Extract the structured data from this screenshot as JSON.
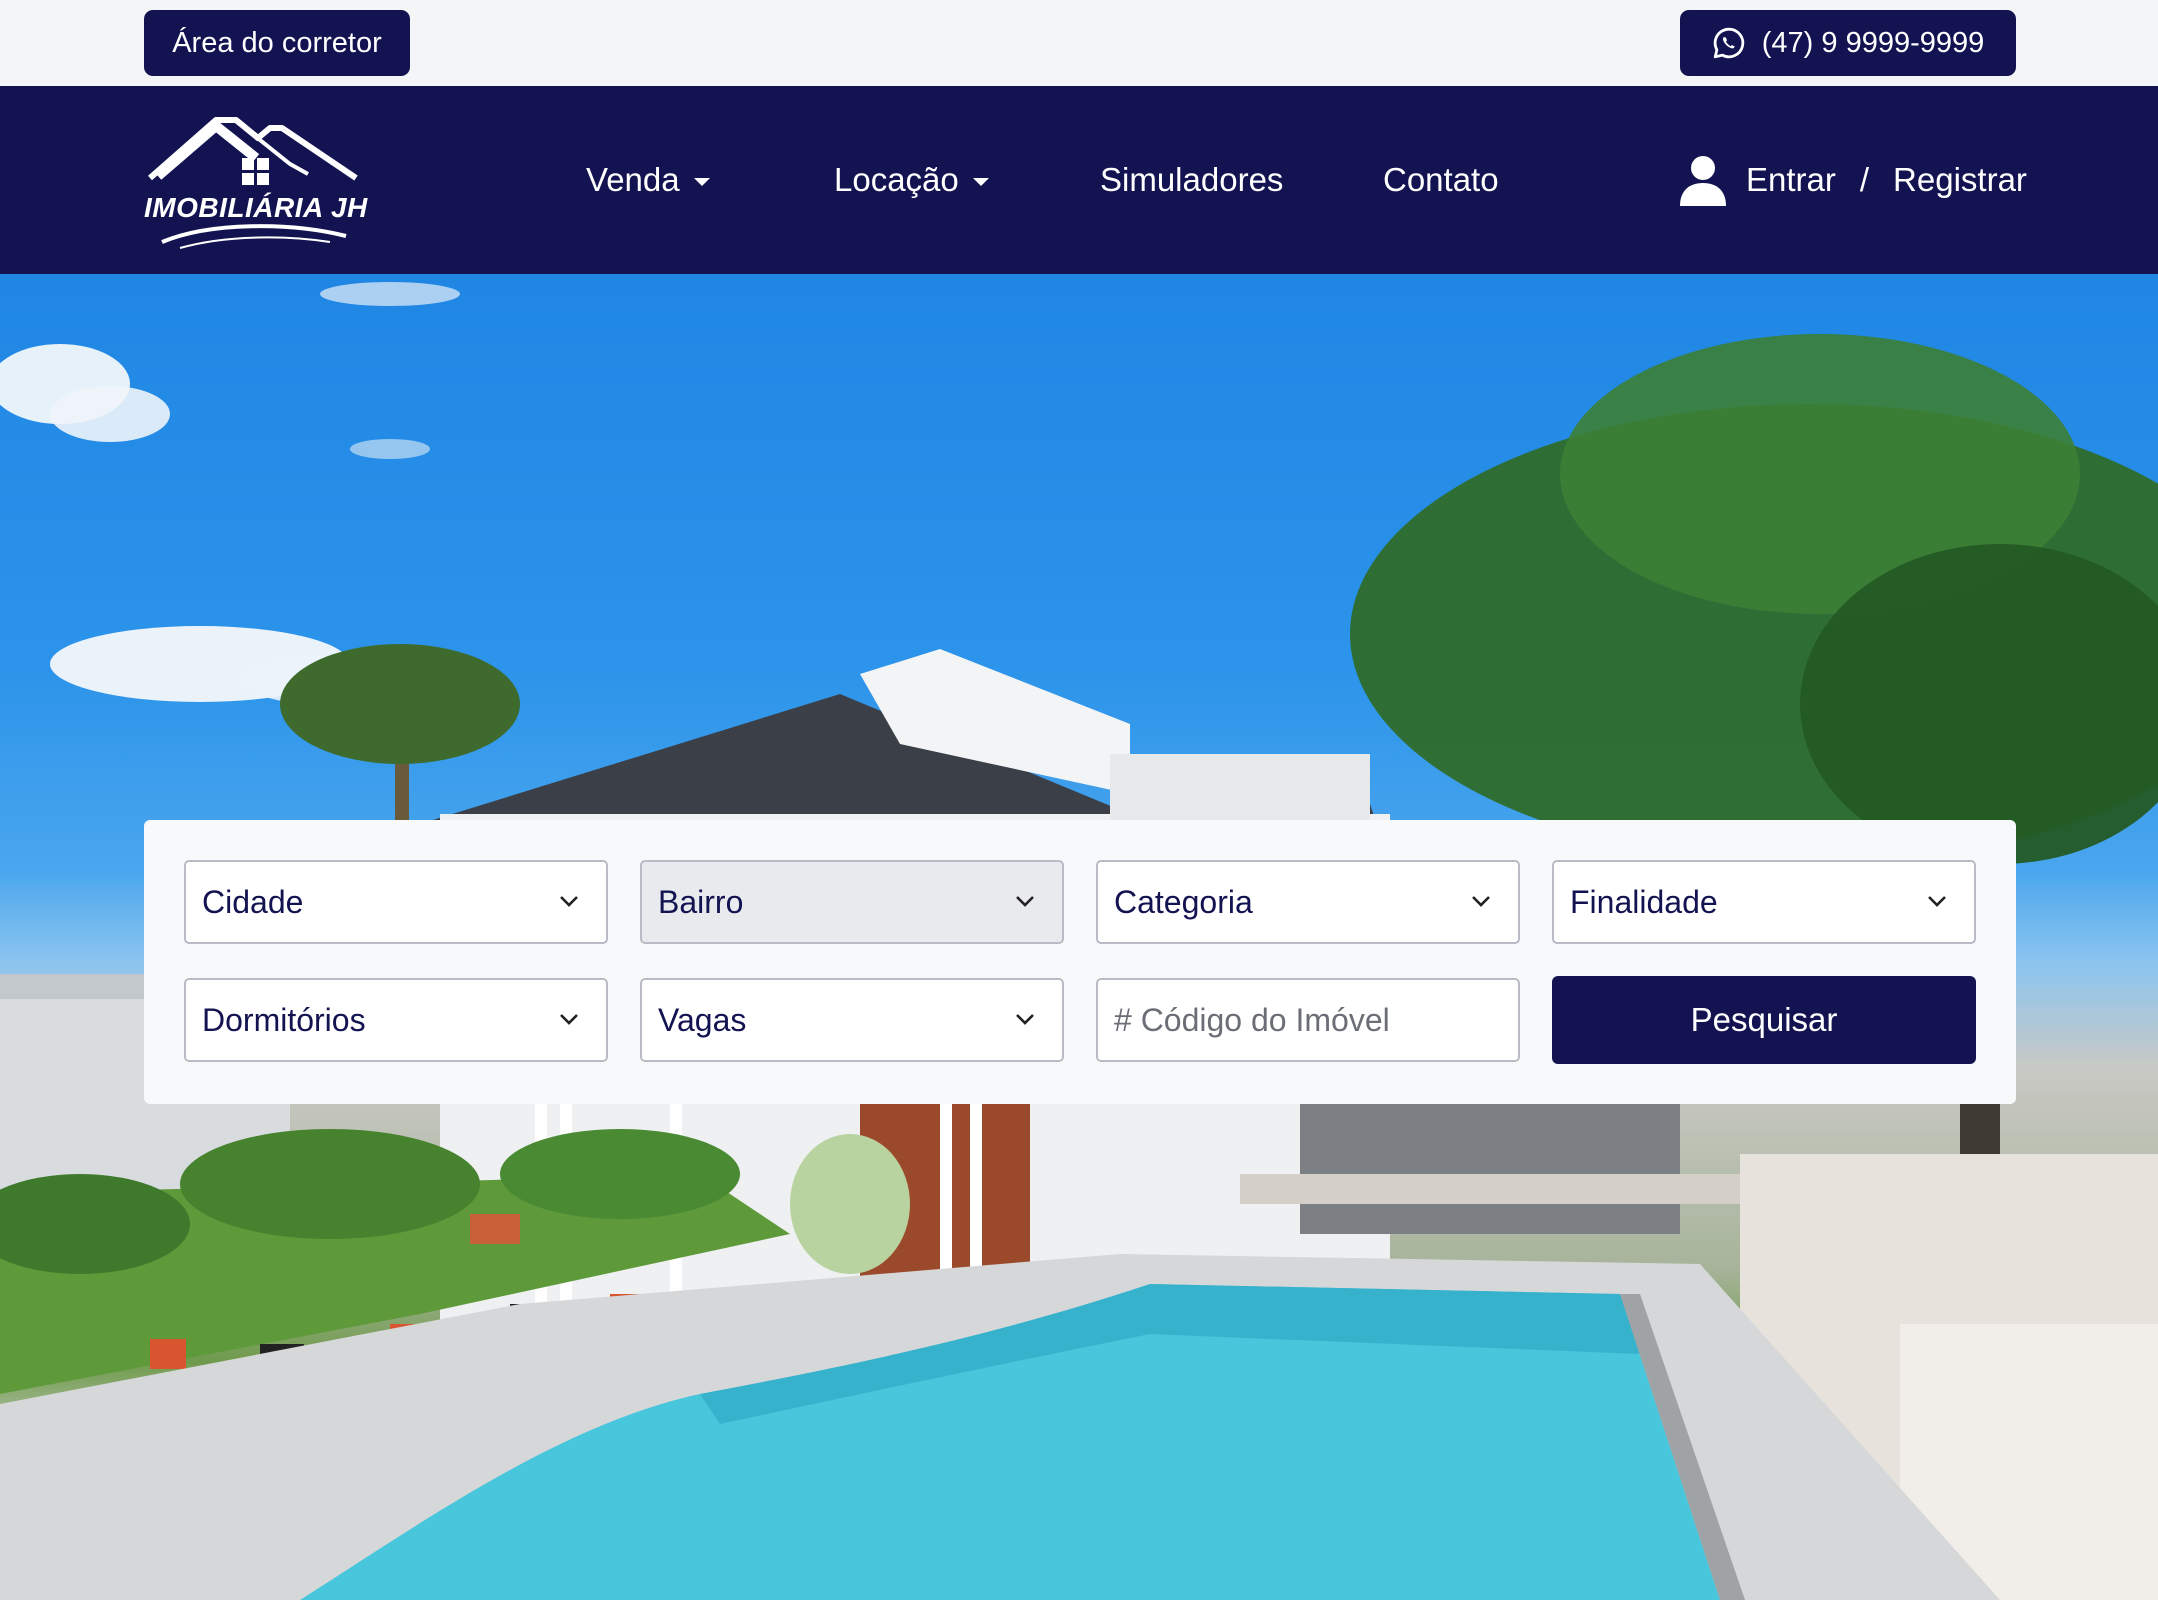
{
  "topbar": {
    "broker_area_label": "Área do corretor",
    "phone_label": "(47) 9 9999-9999",
    "phone_icon": "whatsapp-icon"
  },
  "nav": {
    "logo_text": "IMOBILIÁRIA JH",
    "items": [
      {
        "label": "Venda",
        "dropdown": true
      },
      {
        "label": "Locação",
        "dropdown": true
      },
      {
        "label": "Simuladores",
        "dropdown": false
      },
      {
        "label": "Contato",
        "dropdown": false
      }
    ],
    "login_label": "Entrar",
    "separator": "/",
    "register_label": "Registrar",
    "user_icon": "user-icon"
  },
  "search": {
    "city": "Cidade",
    "neighborhood": "Bairro",
    "category": "Categoria",
    "purpose": "Finalidade",
    "bedrooms": "Dormitórios",
    "parking": "Vagas",
    "code_placeholder": "# Código do Imóvel",
    "submit_label": "Pesquisar"
  },
  "colors": {
    "brand_navy": "#131352",
    "background": "#f4f5f7",
    "white": "#ffffff"
  }
}
